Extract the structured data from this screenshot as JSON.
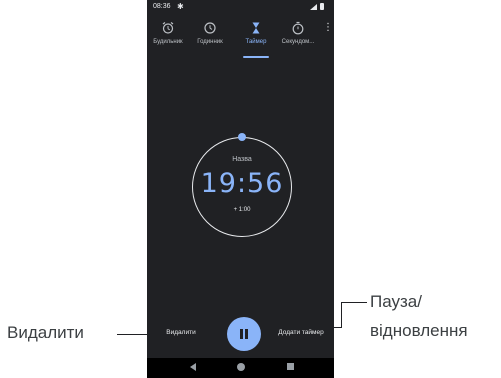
{
  "status_bar": {
    "time": "08:36",
    "settings_icon": "gear-icon",
    "signal_icon": "signal-icon",
    "battery_icon": "battery-icon"
  },
  "tabs": [
    {
      "label": "Будильник",
      "icon": "alarm-icon",
      "active": false
    },
    {
      "label": "Годинник",
      "icon": "clock-icon",
      "active": false
    },
    {
      "label": "Таймер",
      "icon": "hourglass-icon",
      "active": true
    },
    {
      "label": "Секундом...",
      "icon": "stopwatch-icon",
      "active": false
    }
  ],
  "timer": {
    "label": "Назва",
    "time": "19:56",
    "add_minute": "+ 1:00"
  },
  "controls": {
    "delete_label": "Видалити",
    "add_timer_label": "Додати таймер",
    "pause_icon": "pause-icon"
  },
  "nav": {
    "back_icon": "back-icon",
    "home_icon": "home-icon",
    "recents_icon": "recents-icon"
  },
  "callouts": {
    "delete": "Видалити",
    "pause_line1": "Пауза/",
    "pause_line2": "відновлення"
  },
  "colors": {
    "background": "#202124",
    "accent": "#8ab4f8",
    "text": "#e8eaed"
  }
}
